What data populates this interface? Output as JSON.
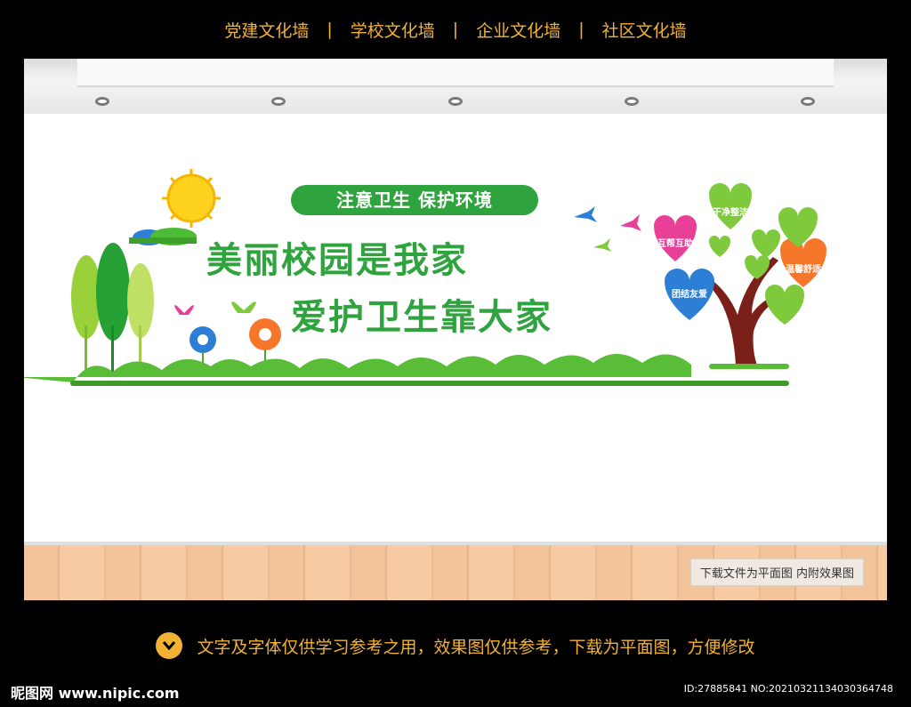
{
  "top_nav": [
    "党建文化墙",
    "学校文化墙",
    "企业文化墙",
    "社区文化墙"
  ],
  "top_nav_separator": "|",
  "wall": {
    "slogan_top": "注意卫生  保护环境",
    "line1": "美丽校园是我家",
    "line2": "爱护卫生靠大家",
    "hearts": [
      "干净整洁",
      "互帮互助",
      "温馨舒适",
      "团结友爱"
    ]
  },
  "floor_note": "下载文件为平面图  内附效果图",
  "bottom_notice": "文字及字体仅供学习参考之用，效果图仅供参考，下载为平面图，方便修改",
  "logo": "昵图网 www.nipic.com",
  "id_text": "ID:27885841 NO:20210321134030364748",
  "colors": {
    "gold": "#f2b233",
    "green": "#2fa33e",
    "lightgreen": "#66c43a"
  }
}
